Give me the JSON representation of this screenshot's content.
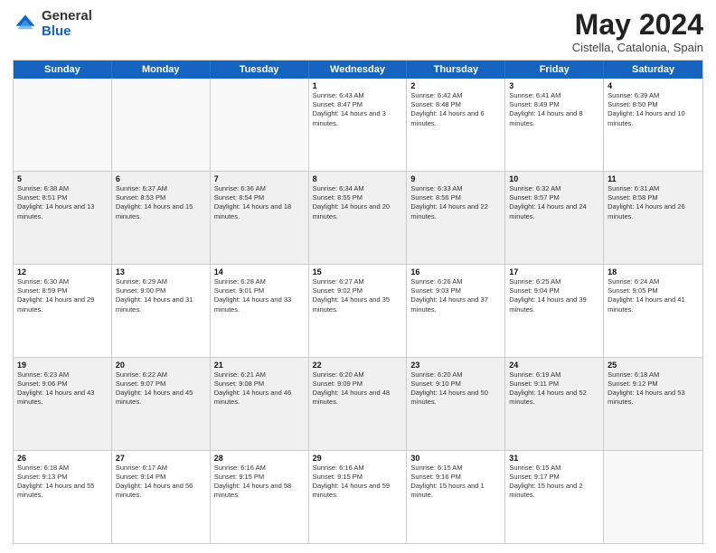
{
  "logo": {
    "general": "General",
    "blue": "Blue"
  },
  "title": "May 2024",
  "subtitle": "Cistella, Catalonia, Spain",
  "days": [
    "Sunday",
    "Monday",
    "Tuesday",
    "Wednesday",
    "Thursday",
    "Friday",
    "Saturday"
  ],
  "weeks": [
    [
      {
        "date": "",
        "sunrise": "",
        "sunset": "",
        "daylight": ""
      },
      {
        "date": "",
        "sunrise": "",
        "sunset": "",
        "daylight": ""
      },
      {
        "date": "",
        "sunrise": "",
        "sunset": "",
        "daylight": ""
      },
      {
        "date": "1",
        "sunrise": "Sunrise: 6:43 AM",
        "sunset": "Sunset: 8:47 PM",
        "daylight": "Daylight: 14 hours and 3 minutes."
      },
      {
        "date": "2",
        "sunrise": "Sunrise: 6:42 AM",
        "sunset": "Sunset: 8:48 PM",
        "daylight": "Daylight: 14 hours and 6 minutes."
      },
      {
        "date": "3",
        "sunrise": "Sunrise: 6:41 AM",
        "sunset": "Sunset: 8:49 PM",
        "daylight": "Daylight: 14 hours and 8 minutes."
      },
      {
        "date": "4",
        "sunrise": "Sunrise: 6:39 AM",
        "sunset": "Sunset: 8:50 PM",
        "daylight": "Daylight: 14 hours and 10 minutes."
      }
    ],
    [
      {
        "date": "5",
        "sunrise": "Sunrise: 6:38 AM",
        "sunset": "Sunset: 8:51 PM",
        "daylight": "Daylight: 14 hours and 13 minutes."
      },
      {
        "date": "6",
        "sunrise": "Sunrise: 6:37 AM",
        "sunset": "Sunset: 8:53 PM",
        "daylight": "Daylight: 14 hours and 15 minutes."
      },
      {
        "date": "7",
        "sunrise": "Sunrise: 6:36 AM",
        "sunset": "Sunset: 8:54 PM",
        "daylight": "Daylight: 14 hours and 18 minutes."
      },
      {
        "date": "8",
        "sunrise": "Sunrise: 6:34 AM",
        "sunset": "Sunset: 8:55 PM",
        "daylight": "Daylight: 14 hours and 20 minutes."
      },
      {
        "date": "9",
        "sunrise": "Sunrise: 6:33 AM",
        "sunset": "Sunset: 8:56 PM",
        "daylight": "Daylight: 14 hours and 22 minutes."
      },
      {
        "date": "10",
        "sunrise": "Sunrise: 6:32 AM",
        "sunset": "Sunset: 8:57 PM",
        "daylight": "Daylight: 14 hours and 24 minutes."
      },
      {
        "date": "11",
        "sunrise": "Sunrise: 6:31 AM",
        "sunset": "Sunset: 8:58 PM",
        "daylight": "Daylight: 14 hours and 26 minutes."
      }
    ],
    [
      {
        "date": "12",
        "sunrise": "Sunrise: 6:30 AM",
        "sunset": "Sunset: 8:59 PM",
        "daylight": "Daylight: 14 hours and 29 minutes."
      },
      {
        "date": "13",
        "sunrise": "Sunrise: 6:29 AM",
        "sunset": "Sunset: 9:00 PM",
        "daylight": "Daylight: 14 hours and 31 minutes."
      },
      {
        "date": "14",
        "sunrise": "Sunrise: 6:28 AM",
        "sunset": "Sunset: 9:01 PM",
        "daylight": "Daylight: 14 hours and 33 minutes."
      },
      {
        "date": "15",
        "sunrise": "Sunrise: 6:27 AM",
        "sunset": "Sunset: 9:02 PM",
        "daylight": "Daylight: 14 hours and 35 minutes."
      },
      {
        "date": "16",
        "sunrise": "Sunrise: 6:26 AM",
        "sunset": "Sunset: 9:03 PM",
        "daylight": "Daylight: 14 hours and 37 minutes."
      },
      {
        "date": "17",
        "sunrise": "Sunrise: 6:25 AM",
        "sunset": "Sunset: 9:04 PM",
        "daylight": "Daylight: 14 hours and 39 minutes."
      },
      {
        "date": "18",
        "sunrise": "Sunrise: 6:24 AM",
        "sunset": "Sunset: 9:05 PM",
        "daylight": "Daylight: 14 hours and 41 minutes."
      }
    ],
    [
      {
        "date": "19",
        "sunrise": "Sunrise: 6:23 AM",
        "sunset": "Sunset: 9:06 PM",
        "daylight": "Daylight: 14 hours and 43 minutes."
      },
      {
        "date": "20",
        "sunrise": "Sunrise: 6:22 AM",
        "sunset": "Sunset: 9:07 PM",
        "daylight": "Daylight: 14 hours and 45 minutes."
      },
      {
        "date": "21",
        "sunrise": "Sunrise: 6:21 AM",
        "sunset": "Sunset: 9:08 PM",
        "daylight": "Daylight: 14 hours and 46 minutes."
      },
      {
        "date": "22",
        "sunrise": "Sunrise: 6:20 AM",
        "sunset": "Sunset: 9:09 PM",
        "daylight": "Daylight: 14 hours and 48 minutes."
      },
      {
        "date": "23",
        "sunrise": "Sunrise: 6:20 AM",
        "sunset": "Sunset: 9:10 PM",
        "daylight": "Daylight: 14 hours and 50 minutes."
      },
      {
        "date": "24",
        "sunrise": "Sunrise: 6:19 AM",
        "sunset": "Sunset: 9:11 PM",
        "daylight": "Daylight: 14 hours and 52 minutes."
      },
      {
        "date": "25",
        "sunrise": "Sunrise: 6:18 AM",
        "sunset": "Sunset: 9:12 PM",
        "daylight": "Daylight: 14 hours and 53 minutes."
      }
    ],
    [
      {
        "date": "26",
        "sunrise": "Sunrise: 6:18 AM",
        "sunset": "Sunset: 9:13 PM",
        "daylight": "Daylight: 14 hours and 55 minutes."
      },
      {
        "date": "27",
        "sunrise": "Sunrise: 6:17 AM",
        "sunset": "Sunset: 9:14 PM",
        "daylight": "Daylight: 14 hours and 56 minutes."
      },
      {
        "date": "28",
        "sunrise": "Sunrise: 6:16 AM",
        "sunset": "Sunset: 9:15 PM",
        "daylight": "Daylight: 14 hours and 58 minutes."
      },
      {
        "date": "29",
        "sunrise": "Sunrise: 6:16 AM",
        "sunset": "Sunset: 9:15 PM",
        "daylight": "Daylight: 14 hours and 59 minutes."
      },
      {
        "date": "30",
        "sunrise": "Sunrise: 6:15 AM",
        "sunset": "Sunset: 9:16 PM",
        "daylight": "Daylight: 15 hours and 1 minute."
      },
      {
        "date": "31",
        "sunrise": "Sunrise: 6:15 AM",
        "sunset": "Sunset: 9:17 PM",
        "daylight": "Daylight: 15 hours and 2 minutes."
      },
      {
        "date": "",
        "sunrise": "",
        "sunset": "",
        "daylight": ""
      }
    ]
  ]
}
